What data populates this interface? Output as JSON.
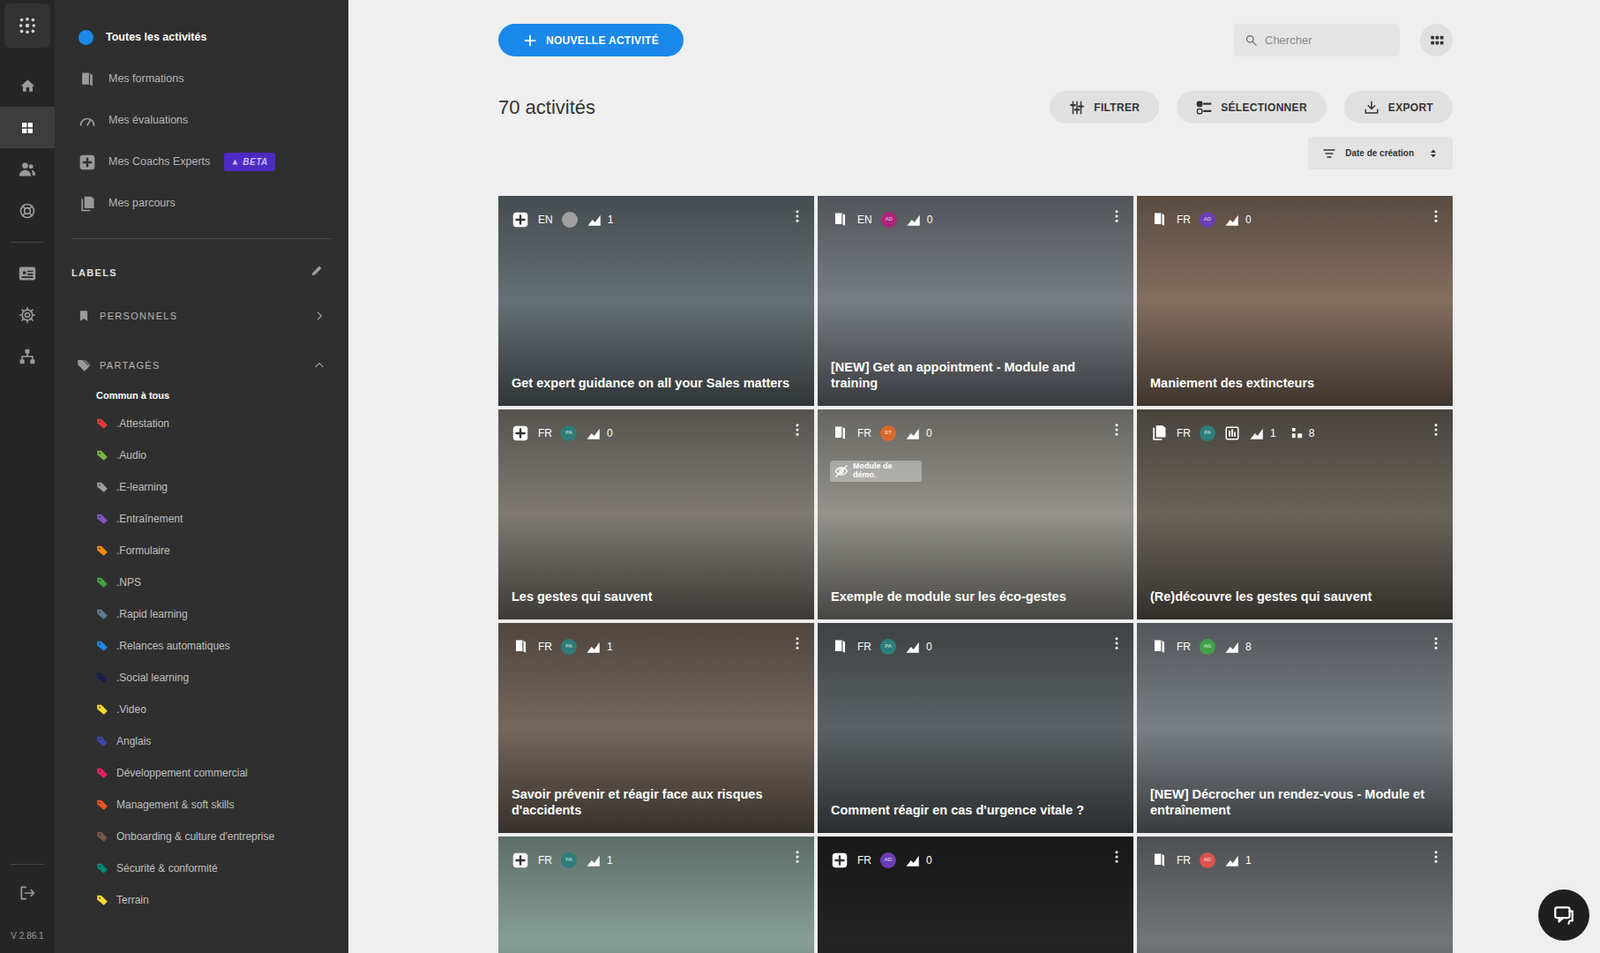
{
  "rail": {
    "top": [
      {
        "kind": "home",
        "selected": false
      },
      {
        "kind": "activities",
        "selected": true
      },
      {
        "kind": "users",
        "selected": false
      },
      {
        "kind": "support",
        "selected": false
      }
    ],
    "middle": [
      {
        "kind": "id-card",
        "selected": false
      },
      {
        "kind": "settings",
        "selected": false
      },
      {
        "kind": "network",
        "selected": false
      }
    ],
    "version": "V 2.86.1"
  },
  "sidebar": {
    "nav": [
      {
        "kind": "all",
        "label": "Toutes les activités",
        "selected": true
      },
      {
        "kind": "book",
        "label": "Mes formations",
        "selected": false
      },
      {
        "kind": "gauge",
        "label": "Mes évaluations",
        "selected": false
      },
      {
        "kind": "expert",
        "label": "Mes Coachs Experts",
        "selected": false,
        "badge": "BETA"
      },
      {
        "kind": "path",
        "label": "Mes parcours",
        "selected": false
      }
    ],
    "labels_title": "LABELS",
    "personal": {
      "label": "PERSONNELS",
      "expanded": false
    },
    "shared": {
      "label": "PARTAGÉS",
      "expanded": true,
      "subgroup": "Commun à tous",
      "labels": [
        {
          "label": ".Attestation",
          "color": "#e53935"
        },
        {
          "label": ".Audio",
          "color": "#7cb342"
        },
        {
          "label": ".E-learning",
          "color": "#9e9e9e"
        },
        {
          "label": ".Entraînement",
          "color": "#7e57c2"
        },
        {
          "label": ".Formulaire",
          "color": "#fb8c00"
        },
        {
          "label": ".NPS",
          "color": "#43a047"
        },
        {
          "label": ".Rapid learning",
          "color": "#607d8b"
        },
        {
          "label": ".Relances automatiques",
          "color": "#1e88e5"
        },
        {
          "label": ".Social learning",
          "color": "#1a1f4e"
        },
        {
          "label": ".Video",
          "color": "#fdd835"
        },
        {
          "label": "Anglais",
          "color": "#3949ab"
        },
        {
          "label": "Développement commercial",
          "color": "#e91e63"
        },
        {
          "label": "Management & soft skills",
          "color": "#f4511e"
        },
        {
          "label": "Onboarding & culture d'entreprise",
          "color": "#795548"
        },
        {
          "label": "Sécurité & conformité",
          "color": "#00897b"
        },
        {
          "label": "Terrain",
          "color": "#fdd835"
        }
      ]
    }
  },
  "toolbar": {
    "new_button": "NOUVELLE ACTIVITÉ",
    "search": {
      "placeholder": "Chercher"
    }
  },
  "count": "70 activités",
  "actions": [
    {
      "kind": "filter",
      "label": "FILTRER"
    },
    {
      "kind": "select",
      "label": "SÉLECTIONNER"
    },
    {
      "kind": "export",
      "label": "EXPORT"
    }
  ],
  "sort": {
    "label": "Date de création"
  },
  "cards": [
    {
      "kind": "expert",
      "lang": "EN",
      "avatar": {
        "color": "#a0a0a0"
      },
      "report": false,
      "views": "1",
      "title": "Get expert guidance on all your Sales matters"
    },
    {
      "kind": "module",
      "lang": "EN",
      "avatar": {
        "initials": "AD",
        "color": "#b0237a"
      },
      "report": false,
      "views": "0",
      "title": "[NEW] Get an appointment - Module and training"
    },
    {
      "kind": "module",
      "lang": "FR",
      "avatar": {
        "initials": "AD",
        "color": "#6a3fb5"
      },
      "report": false,
      "views": "0",
      "title": "Maniement des extincteurs"
    },
    {
      "kind": "expert",
      "lang": "FR",
      "avatar": {
        "initials": "PA",
        "color": "#2e7d7a"
      },
      "report": false,
      "views": "0",
      "title": "Les gestes qui sauvent"
    },
    {
      "kind": "module",
      "lang": "FR",
      "avatar": {
        "initials": "ET",
        "color": "#d9682b"
      },
      "report": false,
      "views": "0",
      "title": "Exemple de module sur les éco-gestes",
      "badge": "Module de démo."
    },
    {
      "kind": "path",
      "lang": "FR",
      "avatar": {
        "initials": "PA",
        "color": "#2e7d7a"
      },
      "report": true,
      "views": "1",
      "participants": "8",
      "title": "(Re)découvre les gestes qui sauvent"
    },
    {
      "kind": "module",
      "lang": "FR",
      "avatar": {
        "initials": "PA",
        "color": "#2e7d7a"
      },
      "report": false,
      "views": "1",
      "title": "Savoir prévenir et réagir face aux risques d'accidents"
    },
    {
      "kind": "module",
      "lang": "FR",
      "avatar": {
        "initials": "PA",
        "color": "#2e7d7a"
      },
      "report": false,
      "views": "0",
      "title": "Comment réagir en cas d'urgence vitale ?"
    },
    {
      "kind": "module",
      "lang": "FR",
      "avatar": {
        "initials": "AG",
        "color": "#43a047"
      },
      "report": false,
      "views": "8",
      "title": "[NEW] Décrocher un rendez-vous - Module et entraînement"
    },
    {
      "kind": "expert",
      "lang": "FR",
      "avatar": {
        "initials": "PA",
        "color": "#2e7d7a"
      },
      "report": false,
      "views": "1"
    },
    {
      "kind": "expert",
      "lang": "FR",
      "avatar": {
        "initials": "AD",
        "color": "#6a3fb5"
      },
      "report": false,
      "views": "0"
    },
    {
      "kind": "module",
      "lang": "FR",
      "avatar": {
        "initials": "AD",
        "color": "#d9534f"
      },
      "report": false,
      "views": "1"
    }
  ]
}
